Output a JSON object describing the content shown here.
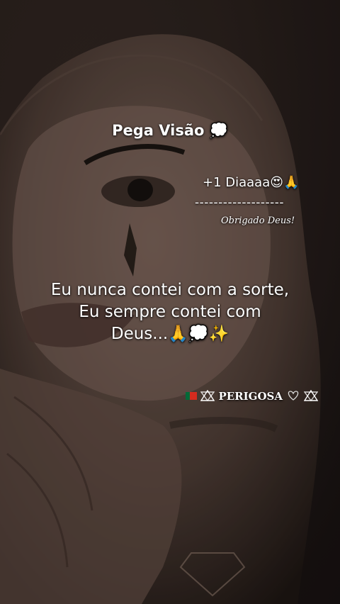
{
  "post": {
    "title": "Pega Visão 💭",
    "day_counter": "+1 Diaaaa😍🙏",
    "divider": "-------------------",
    "thanks": "Obrigado Deus!",
    "quote_lines": [
      "Eu nunca contei com a sorte,",
      "Eu sempre contei com",
      "Deus...🙏💭✨"
    ],
    "signature": "PERIGOSA"
  },
  "colors": {
    "text": "#ffffff",
    "background": "#3a2c26"
  }
}
